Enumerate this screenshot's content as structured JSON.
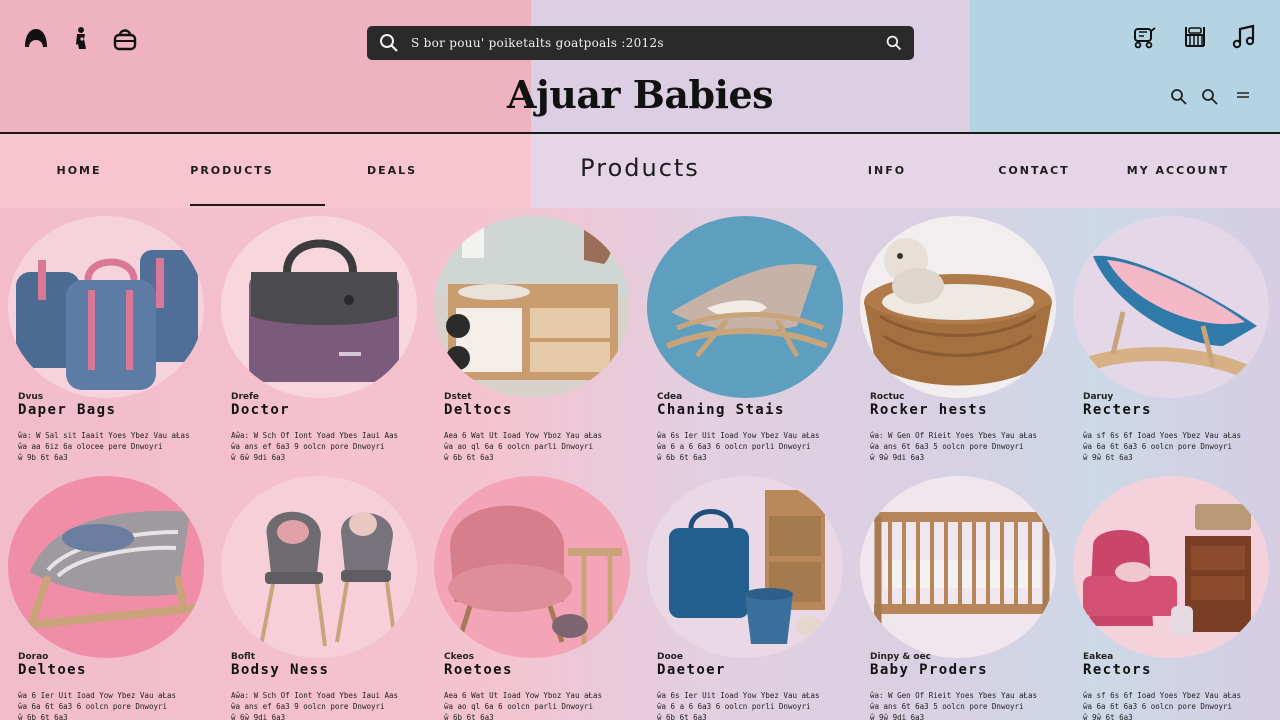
{
  "header": {
    "brand": "Ajuar Babies",
    "search": {
      "value": "S bor pouu' poiketalts goatpoals :2012s"
    },
    "colors": {
      "pink": "#eeb2c0",
      "lilac": "#dccfe3",
      "blue": "#b4d4e4"
    },
    "icons_left": [
      "baby-head-icon",
      "pacifier-icon",
      "bag-icon"
    ],
    "icons_right": [
      "stroller-icon",
      "crib-icon",
      "music-icon"
    ],
    "mini_icons": [
      "search-icon",
      "search-icon",
      "menu-icon"
    ]
  },
  "nav": {
    "items": [
      "HOME",
      "PRODUCTS",
      "DEALS",
      "INFO",
      "CONTACT",
      "MY ACCOUNT"
    ],
    "active": "PRODUCTS",
    "title": "Products"
  },
  "products": [
    {
      "category": "Dvus",
      "name": "Daper Bags",
      "desc": [
        "ŵa: W Sal sit Iaait Yoes Ybez Vau aŁas",
        "ŵa aa 6iz 6a olocee pere Dnwoyri",
        "ŵ 9b 6t 6a3"
      ],
      "image": "diaper-bags"
    },
    {
      "category": "Drefe",
      "name": "Doctor",
      "desc": [
        "Aŵa: W Sch Of Iont Yoad Ybes Iaui Aas",
        "ŵa ans ef 6a3 9 oolcn pore Dnwoyri",
        "ŵ 6ŵ 9di 6a3"
      ],
      "image": "handbag"
    },
    {
      "category": "Dstet",
      "name": "Deltocs",
      "desc": [
        "Aea 6 Wat Ut Ioad Yow Yboz Yau aŁas",
        "ŵa ao ql 6a 6 oolcn parli Dnwoyri",
        "ŵ 6b 6t 6a3"
      ],
      "image": "changing-dresser"
    },
    {
      "category": "Cdea",
      "name": "Chaning Stais",
      "desc": [
        "ŵa 6s Ier Uit Ioad Yow Ybez Vau aŁas",
        "ŵa 6 a 6 6a3 6 oolcn porli Dnwoyri",
        "ŵ 6b 6t 6a3"
      ],
      "image": "rocker-chair"
    },
    {
      "category": "Roctuc",
      "name": "Rocker hests",
      "desc": [
        "ŵa: W Gen Of Rieit Yoes Ybes Yau aŁas",
        "ŵa ans 6t 6a3 5 oolcn pore Dnwoyri",
        "ŵ 9ŵ 9di 6a3"
      ],
      "image": "basket-bassinet"
    },
    {
      "category": "Daruy",
      "name": "Recters",
      "desc": [
        "ŵa sf 6s 6f Ioad Yoes Ybez Vau aŁas",
        "ŵa 6a 6t 6a3 6 oolcn pore Dnwoyri",
        "ŵ 9ŵ 6t 6a3"
      ],
      "image": "rocking-bassinet"
    },
    {
      "category": "Dorao",
      "name": "Deltoes",
      "desc": [
        "ŵa 6 Ier Uit Ioad Yow Ybez Vau aŁas",
        "ŵa 6a 6t 6a3 6 oolcn pore Dnwoyri",
        "ŵ 6b 6t 6a3"
      ],
      "image": "lounger"
    },
    {
      "category": "Boflt",
      "name": "Bodsy Ness",
      "desc": [
        "Aŵa: W Sch Of Iont Yoad Ybes Iaui Aas",
        "ŵa ans ef 6a3 9 oolcn pore Dnwoyri",
        "ŵ 6ŵ 9di 6a3"
      ],
      "image": "chairs"
    },
    {
      "category": "Ckeos",
      "name": "Roetoes",
      "desc": [
        "Aea 6 Wat Ut Ioad Yow Yboz Yau aŁas",
        "ŵa ao ql 6a 6 oolcn parli Dnwoyri",
        "ŵ 6b 6t 6a3"
      ],
      "image": "armchair"
    },
    {
      "category": "Dooe",
      "name": "Daetoer",
      "desc": [
        "ŵa 6s Ier Uit Ioad Yow Ybez Vau aŁas",
        "ŵa 6 a 6 6a3 6 oolcn porli Dnwoyri",
        "ŵ 6b 6t 6a3"
      ],
      "image": "bags-shelf"
    },
    {
      "category": "Dinpy & oec",
      "name": "Baby Proders",
      "desc": [
        "ŵa: W Gen Of Rieit Yoes Ybes Yau aŁas",
        "ŵa ans 6t 6a3 5 oolcn pore Dnwoyri",
        "ŵ 9ŵ 9di 6a3"
      ],
      "image": "crib"
    },
    {
      "category": "Eakea",
      "name": "Rectors",
      "desc": [
        "ŵa sf 6s 6f Ioad Yoes Ybez Vau aŁas",
        "ŵa 6a 6t 6a3 6 oolcn pore Dnwoyri",
        "ŵ 9ŵ 6t 6a3"
      ],
      "image": "nursery-set"
    }
  ]
}
